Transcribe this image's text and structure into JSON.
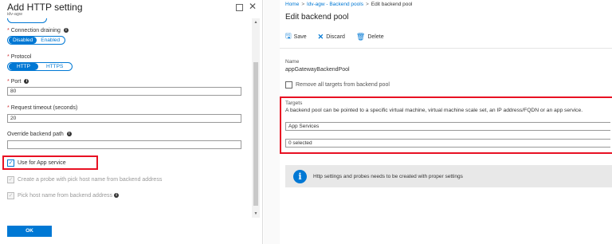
{
  "left_blade": {
    "title": "Add HTTP setting",
    "subtitle": "idv-agw",
    "connection_draining": {
      "label": "Connection draining",
      "options": [
        "Disabled",
        "Enabled"
      ],
      "selected": "Disabled"
    },
    "protocol": {
      "label": "Protocol",
      "options": [
        "HTTP",
        "HTTPS"
      ],
      "selected": "HTTP"
    },
    "port": {
      "label": "Port",
      "value": "80"
    },
    "request_timeout": {
      "label": "Request timeout (seconds)",
      "value": "20"
    },
    "override_backend_path": {
      "label": "Override backend path",
      "value": ""
    },
    "use_for_app_service": {
      "label": "Use for App service",
      "checked": true
    },
    "create_probe": {
      "label": "Create a probe with pick host name from backend address",
      "checked": true,
      "disabled": true
    },
    "pick_host_name": {
      "label": "Pick host name from backend address",
      "checked": true,
      "disabled": true
    },
    "ok_label": "OK",
    "required_mark": "*",
    "info_glyph": "i"
  },
  "right_blade": {
    "breadcrumb": [
      "Home",
      "ldv-agw - Backend pools",
      "Edit backend pool"
    ],
    "breadcrumb_sep": ">",
    "title": "Edit backend pool",
    "toolbar": {
      "save": "Save",
      "discard": "Discard",
      "delete": "Delete"
    },
    "name_label": "Name",
    "name_value": "appGatewayBackendPool",
    "remove_all_label": "Remove all targets from backend pool",
    "targets_label": "Targets",
    "targets_description": "A backend pool can be pointed to a specific virtual machine, virtual machine scale set, an IP address/FQDN or an app service.",
    "target_type_value": "App Services",
    "target_selection_value": "0 selected",
    "notice_text": "Http settings and probes needs to be created with proper settings",
    "notice_glyph": "i"
  },
  "colors": {
    "accent": "#0078d4",
    "highlight": "#e81123",
    "required": "#d13438"
  }
}
